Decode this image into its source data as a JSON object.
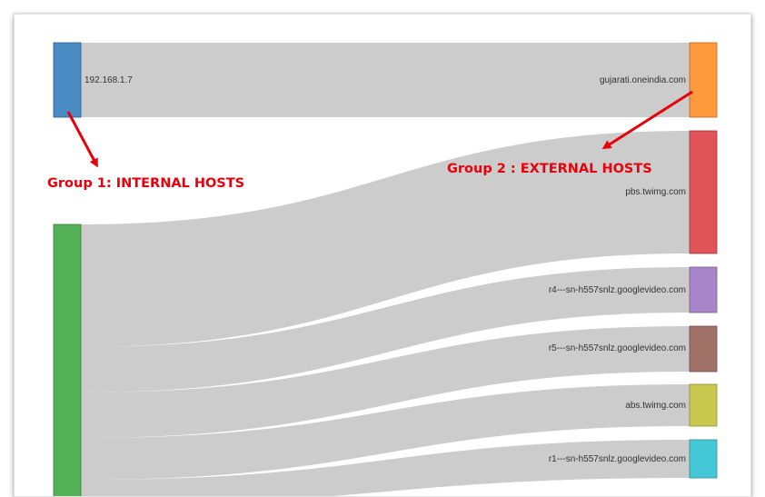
{
  "diagram": {
    "type": "sankey",
    "link_color": "#cccccc",
    "sources": [
      {
        "id": "src1",
        "label": "192.168.1.7",
        "color": "#4a8cc4"
      },
      {
        "id": "src2",
        "label": "",
        "color": "#55b155"
      }
    ],
    "targets": [
      {
        "id": "t1",
        "label": "gujarati.oneindia.com",
        "color": "#ff9a3c"
      },
      {
        "id": "t2",
        "label": "pbs.twimg.com",
        "color": "#e05358"
      },
      {
        "id": "t3",
        "label": "r4---sn-h557snlz.googlevideo.com",
        "color": "#a885c9"
      },
      {
        "id": "t4",
        "label": "r5---sn-h557snlz.googlevideo.com",
        "color": "#a07268"
      },
      {
        "id": "t5",
        "label": "abs.twimg.com",
        "color": "#c9c84f"
      },
      {
        "id": "t6",
        "label": "r1---sn-h557snlz.googlevideo.com",
        "color": "#45c8d6"
      }
    ]
  },
  "annotations": {
    "group1": "Group 1: INTERNAL HOSTS",
    "group2": "Group 2 : EXTERNAL HOSTS",
    "arrow_color": "#e8000b"
  }
}
